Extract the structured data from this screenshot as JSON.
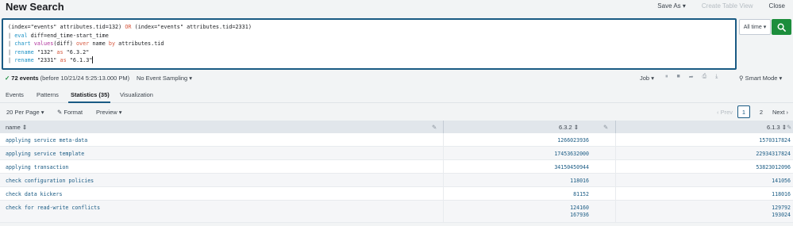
{
  "header": {
    "title": "New Search",
    "save_as": "Save As",
    "create_table_view": "Create Table View",
    "close": "Close"
  },
  "search": {
    "lines": [
      "(index=\"events\" attributes.tid=132) OR (index=\"events\" attributes.tid=2331)",
      "| eval diff=end_time-start_time",
      "| chart values(diff) over name by attributes.tid",
      "| rename \"132\" as \"6.3.2\"",
      "| rename \"2331\" as \"6.1.3\""
    ],
    "time_range": "All time"
  },
  "status": {
    "events_count": "72 events",
    "events_suffix": "(before 10/21/24 5:25:13.000 PM)",
    "sampling": "No Event Sampling",
    "job": "Job",
    "mode": "Smart Mode"
  },
  "tabs": [
    {
      "label": "Events"
    },
    {
      "label": "Patterns"
    },
    {
      "label": "Statistics (35)"
    },
    {
      "label": "Visualization"
    }
  ],
  "controls": {
    "per_page": "20 Per Page",
    "format": "Format",
    "preview": "Preview",
    "prev": "Prev",
    "page1": "1",
    "page2": "2",
    "next": "Next"
  },
  "table": {
    "columns": [
      "name",
      "6.3.2",
      "6.1.3"
    ],
    "rows": [
      {
        "name": "applying service meta-data",
        "v1": [
          "1266023936"
        ],
        "v2": [
          "1570317824"
        ]
      },
      {
        "name": "applying service template",
        "v1": [
          "17453632000"
        ],
        "v2": [
          "22934317824"
        ]
      },
      {
        "name": "applying transaction",
        "v1": [
          "34150450944"
        ],
        "v2": [
          "53823012096"
        ]
      },
      {
        "name": "check configuration policies",
        "v1": [
          "118016"
        ],
        "v2": [
          "141056"
        ]
      },
      {
        "name": "check data kickers",
        "v1": [
          "81152"
        ],
        "v2": [
          "118016"
        ]
      },
      {
        "name": "check for read-write conflicts",
        "v1": [
          "124160",
          "167936"
        ],
        "v2": [
          "129792",
          "193024"
        ]
      }
    ]
  },
  "colors": {
    "accent": "#1a5b84",
    "search_button": "#1c8d3c",
    "keyword": "#d6563c",
    "command": "#1e93c6"
  }
}
